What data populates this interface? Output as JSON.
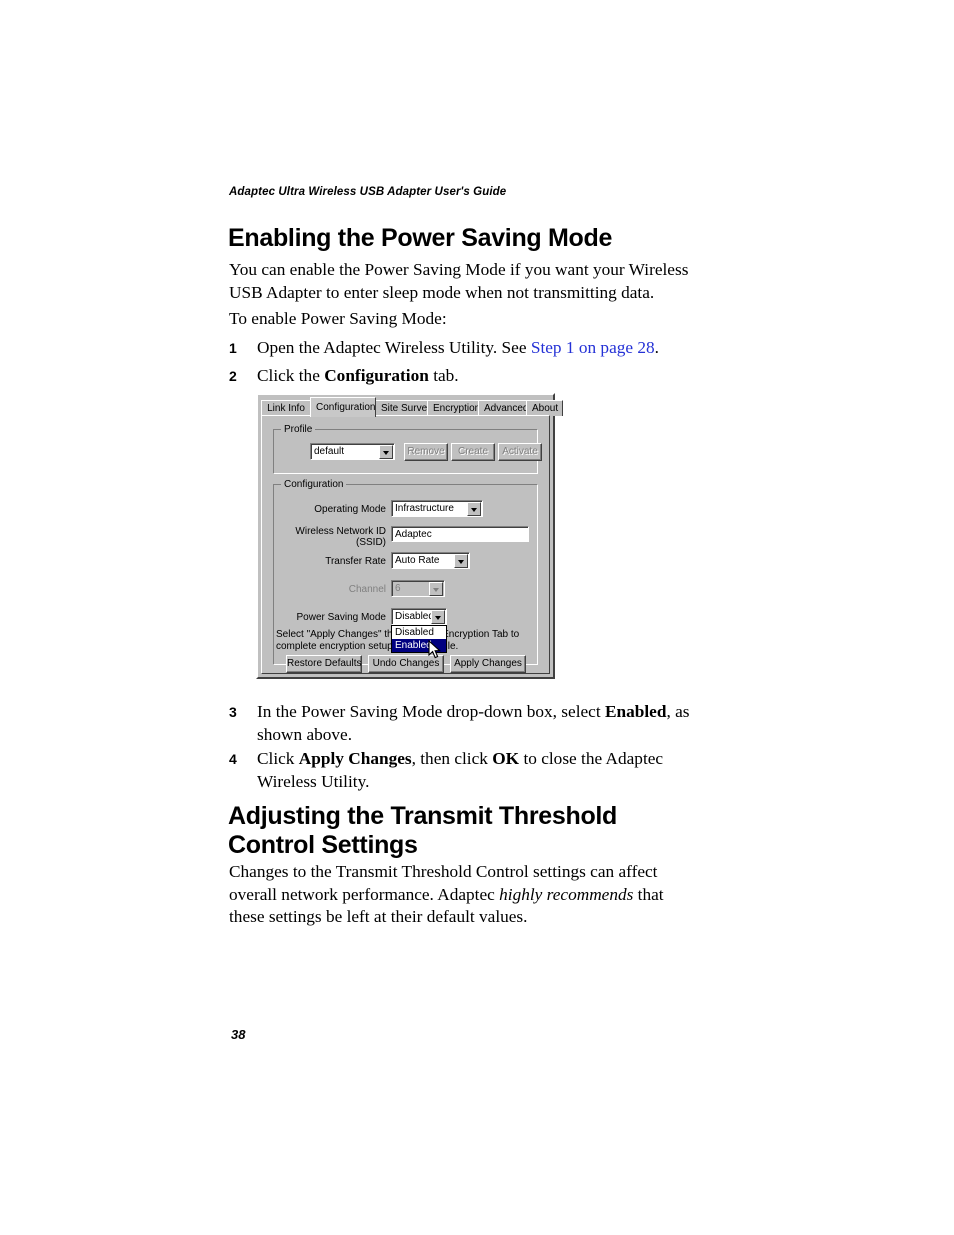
{
  "document": {
    "running_header": "Adaptec Ultra Wireless USB Adapter User's Guide",
    "page_number": "38"
  },
  "sections": {
    "power_saving": {
      "heading": "Enabling the Power Saving Mode",
      "intro": "You can enable the Power Saving Mode if you want your Wireless USB Adapter to enter sleep mode when not transmitting data.",
      "lead_in": "To enable Power Saving Mode:",
      "steps": [
        {
          "number": "1",
          "text_before": "Open the Adaptec Wireless Utility. See ",
          "link": "Step 1 on page 28",
          "text_after": "."
        },
        {
          "number": "2",
          "text_before": "Click the ",
          "bold": "Configuration",
          "text_after": " tab."
        },
        {
          "number": "3",
          "text_before": "In the Power Saving Mode drop-down box, select ",
          "bold": "Enabled",
          "text_after": ", as shown above."
        },
        {
          "number": "4",
          "text_before": "Click ",
          "bold": "Apply Changes",
          "text_mid": ", then click ",
          "bold2": "OK",
          "text_after": " to close the Adaptec Wireless Utility."
        }
      ]
    },
    "transmit_threshold": {
      "heading": "Adjusting the Transmit Threshold Control Settings",
      "body_before": "Changes to the Transmit Threshold Control settings can affect overall network performance. Adaptec ",
      "body_italic": "highly recommends",
      "body_after": " that these settings be left at their default values."
    }
  },
  "screenshot": {
    "tabs": [
      {
        "label": "Link Info",
        "active": false
      },
      {
        "label": "Configuration",
        "active": true
      },
      {
        "label": "Site Survey",
        "active": false
      },
      {
        "label": "Encryption",
        "active": false
      },
      {
        "label": "Advanced",
        "active": false
      },
      {
        "label": "About",
        "active": false
      }
    ],
    "profile_group": {
      "legend": "Profile",
      "combo_value": "default",
      "buttons": [
        {
          "label": "Remove",
          "enabled": false
        },
        {
          "label": "Create",
          "enabled": false
        },
        {
          "label": "Activate",
          "enabled": false
        }
      ]
    },
    "configuration_group": {
      "legend": "Configuration",
      "fields": [
        {
          "label": "Operating Mode",
          "value": "Infrastructure",
          "type": "combo",
          "enabled": true
        },
        {
          "label": "Wireless Network ID",
          "label2": "(SSID)",
          "value": "Adaptec",
          "type": "text",
          "enabled": true
        },
        {
          "label": "Transfer Rate",
          "value": "Auto Rate",
          "type": "combo",
          "enabled": true
        },
        {
          "label": "Channel",
          "value": "6",
          "type": "combo",
          "enabled": false
        },
        {
          "label": "Power Saving Mode",
          "value": "Disabled",
          "type": "combo",
          "enabled": true
        }
      ],
      "open_dropdown": {
        "options": [
          "Disabled",
          "Enabled"
        ],
        "selected": "Enabled",
        "highlight_color": "#000080"
      },
      "hint_line1": "Select \"Apply Changes\" then use the Encryption Tab to",
      "hint_line2": "complete encryption setup for this profile.",
      "hint_line1_visible_left": "Select \"Apply Change",
      "hint_line1_visible_right": "e Encryption Tab to",
      "hint_line2_visible_left": "complete encryption s",
      "hint_line2_visible_right": "ile.",
      "buttons": [
        {
          "label": "Restore Defaults",
          "enabled": true
        },
        {
          "label": "Undo Changes",
          "enabled": true
        },
        {
          "label": "Apply Changes",
          "enabled": true
        }
      ]
    }
  }
}
